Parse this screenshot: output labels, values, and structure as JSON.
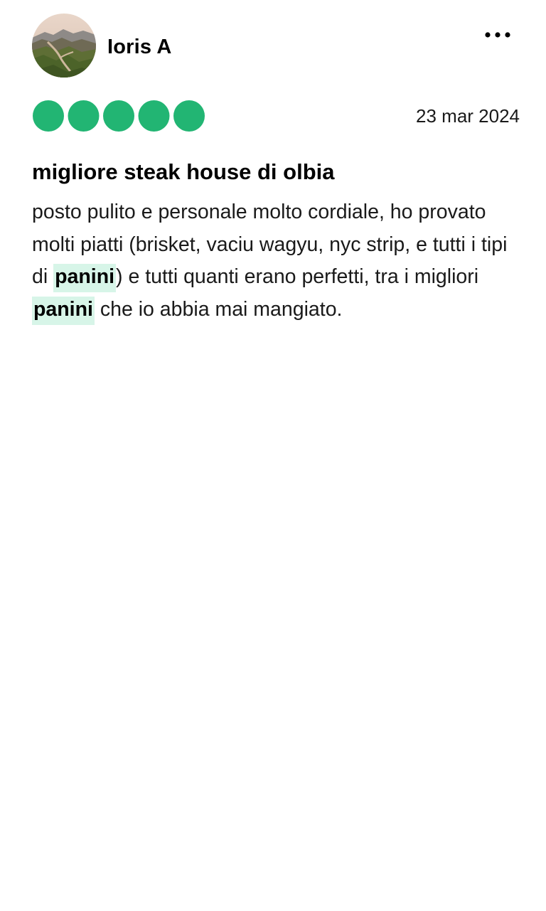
{
  "review": {
    "author": "Ioris A",
    "rating": 5,
    "rating_max": 5,
    "date": "23 mar 2024",
    "title": "migliore steak house di olbia",
    "body": {
      "seg1": "posto pulito e personale molto cordiale, ho provato molti piatti (brisket, vaciu wagyu, nyc strip, e tutti i tipi di ",
      "hl1": "panini",
      "seg2": ") e tutti quanti erano perfetti, tra i migliori ",
      "hl2": "panini",
      "seg3": " che io abbia mai mangiato."
    }
  },
  "icons": {
    "more": "more-horizontal-icon",
    "rating": "rating-bubble-icon"
  },
  "colors": {
    "rating_green": "#22b573",
    "highlight_bg": "#d7f5e8",
    "text": "#1a1a1a"
  }
}
